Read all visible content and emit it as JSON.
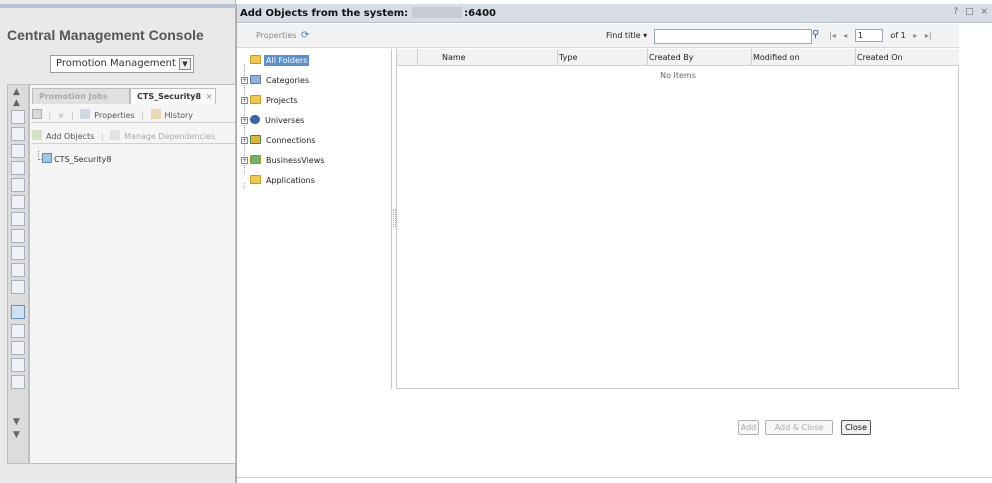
{
  "background": {
    "app_title": "Central Management Console",
    "view_select": "Promotion Management",
    "tabs": [
      {
        "label": "Promotion Jobs"
      },
      {
        "label": "CTS_Security8",
        "close": "×"
      }
    ],
    "toolbar1": {
      "properties": "Properties",
      "history": "History",
      "delete_symbol": "×"
    },
    "toolbar2": {
      "add_objects": "Add Objects",
      "manage_dependencies": "Manage Dependencies"
    },
    "tree_item": "CTS_Security8",
    "strip_icons": [
      "users-icon",
      "info-icon",
      "user-icon",
      "lock-icon",
      "key-icon",
      "settings-icon",
      "server-icon",
      "map-pin-icon",
      "money-icon",
      "document-icon",
      "promotion-icon",
      "calendar-icon",
      "add-icon",
      "edit-icon",
      "image-icon"
    ]
  },
  "dialog": {
    "title_prefix": "Add Objects from the system:",
    "title_port": ":6400",
    "controls": {
      "help": "?",
      "maximize": "□",
      "close": "×"
    },
    "toolbar": {
      "properties": "Properties",
      "find_label": "Find title",
      "find_dropdown": "▾",
      "find_value": "",
      "page_value": "1",
      "page_of": "of 1",
      "first": "|◂",
      "prev": "◂",
      "next": "▸",
      "last": "▸|"
    },
    "tree": [
      {
        "label": "All Folders",
        "selected": true,
        "expandable": false
      },
      {
        "label": "Categories",
        "expandable": true
      },
      {
        "label": "Projects",
        "expandable": true
      },
      {
        "label": "Universes",
        "expandable": true
      },
      {
        "label": "Connections",
        "expandable": true
      },
      {
        "label": "BusinessViews",
        "expandable": true
      },
      {
        "label": "Applications",
        "expandable": false
      }
    ],
    "list": {
      "columns": [
        "Name",
        "Type",
        "Created By",
        "Modified on",
        "Created On"
      ],
      "empty_message": "No Items"
    },
    "buttons": {
      "add": "Add",
      "add_close": "Add & Close",
      "close": "Close"
    }
  },
  "colors": {
    "selection": "#5a8fd0",
    "titlebar": "#d8dde6"
  }
}
